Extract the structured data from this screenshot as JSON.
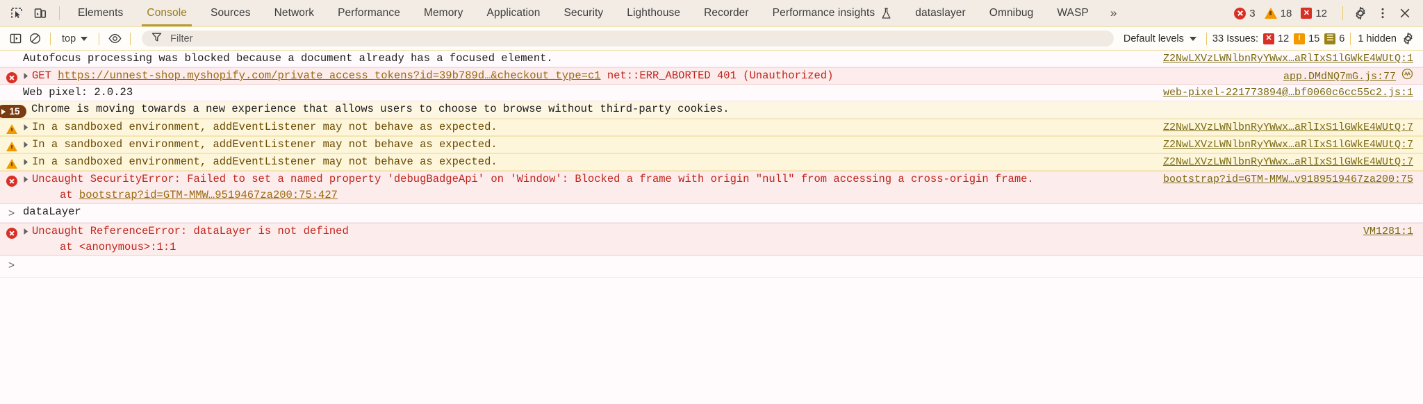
{
  "window": {
    "title": "Chrome DevTools — Console"
  },
  "tabbar": {
    "inspect_icon": "inspect-element-icon",
    "device_icon": "device-toolbar-icon",
    "tabs": [
      {
        "label": "Elements",
        "active": false
      },
      {
        "label": "Console",
        "active": true
      },
      {
        "label": "Sources",
        "active": false
      },
      {
        "label": "Network",
        "active": false
      },
      {
        "label": "Performance",
        "active": false
      },
      {
        "label": "Memory",
        "active": false
      },
      {
        "label": "Application",
        "active": false
      },
      {
        "label": "Security",
        "active": false
      },
      {
        "label": "Lighthouse",
        "active": false
      },
      {
        "label": "Recorder",
        "active": false
      },
      {
        "label": "Performance insights",
        "active": false,
        "icon": "flask-icon"
      },
      {
        "label": "dataslayer",
        "active": false
      },
      {
        "label": "Omnibug",
        "active": false
      },
      {
        "label": "WASP",
        "active": false
      }
    ],
    "more_tabs": "»",
    "counters": {
      "errors": "3",
      "warnings": "18",
      "issues": "12"
    },
    "settings_icon": "gear-icon",
    "more_icon": "kebab-menu-icon",
    "close_icon": "close-icon"
  },
  "console_toolbar": {
    "sidebar_icon": "console-sidebar-icon",
    "clear_icon": "clear-console-icon",
    "context": "top",
    "eye_icon": "live-expression-eye-icon",
    "filter": {
      "icon": "filter-funnel-icon",
      "value": "",
      "placeholder": "Filter"
    },
    "levels": "Default levels",
    "issues_label": "33 Issues:",
    "issue_counts": {
      "errors": "12",
      "warnings": "15",
      "info": "6"
    },
    "hidden_label": "1 hidden",
    "settings_icon": "console-settings-gear-icon"
  },
  "messages": [
    {
      "kind": "plain",
      "text": "Autofocus processing was blocked because a document already has a focused element.",
      "source": "Z2NwLXVzLWNlbnRyYWwx…aRlIxS1lGWkE4WUtQ:1"
    },
    {
      "kind": "error",
      "prefix": "GET ",
      "link": "https://unnest-shop.myshopify.com/private_access_tokens?id=39b789d…&checkout_type=c1",
      "suffix": " net::ERR_ABORTED 401 (Unauthorized)",
      "source": "app.DMdNQ7mG.js:77"
    },
    {
      "kind": "plain",
      "text": "Web pixel: 2.0.23",
      "source": "web-pixel-221773894@…bf0060c6cc55c2.js:1"
    },
    {
      "kind": "info",
      "badge": "15",
      "text": "Chrome is moving towards a new experience that allows users to choose to browse without third-party cookies.",
      "source": ""
    },
    {
      "kind": "warn",
      "text": "In a sandboxed environment, addEventListener may not behave as expected.",
      "source": "Z2NwLXVzLWNlbnRyYWwx…aRlIxS1lGWkE4WUtQ:7"
    },
    {
      "kind": "warn",
      "text": "In a sandboxed environment, addEventListener may not behave as expected.",
      "source": "Z2NwLXVzLWNlbnRyYWwx…aRlIxS1lGWkE4WUtQ:7"
    },
    {
      "kind": "warn",
      "text": "In a sandboxed environment, addEventListener may not behave as expected.",
      "source": "Z2NwLXVzLWNlbnRyYWwx…aRlIxS1lGWkE4WUtQ:7"
    },
    {
      "kind": "error",
      "text": "Uncaught SecurityError: Failed to set a named property 'debugBadgeApi' on 'Window': Blocked a frame with origin \"null\" from accessing a cross-origin frame.",
      "stack_prefix": "at ",
      "stack_link": "bootstrap?id=GTM-MMW…9519467za200:75:427",
      "source": "bootstrap?id=GTM-MMW…v9189519467za200:75"
    },
    {
      "kind": "input",
      "text": "dataLayer"
    },
    {
      "kind": "error",
      "text": "Uncaught ReferenceError: dataLayer is not defined",
      "stack_prefix": "at ",
      "stack_link": "<anonymous>:1:1",
      "stack_plain": "at <anonymous>:1:1",
      "source": "VM1281:1"
    }
  ],
  "prompt": {
    "caret": ">"
  },
  "colors": {
    "tabbar_bg": "#f2ece4",
    "accent": "#b99b38",
    "error_bg": "#fdecec",
    "warn_bg": "#fdf6db",
    "error_text": "#c0241a",
    "link": "#7a6a12"
  }
}
